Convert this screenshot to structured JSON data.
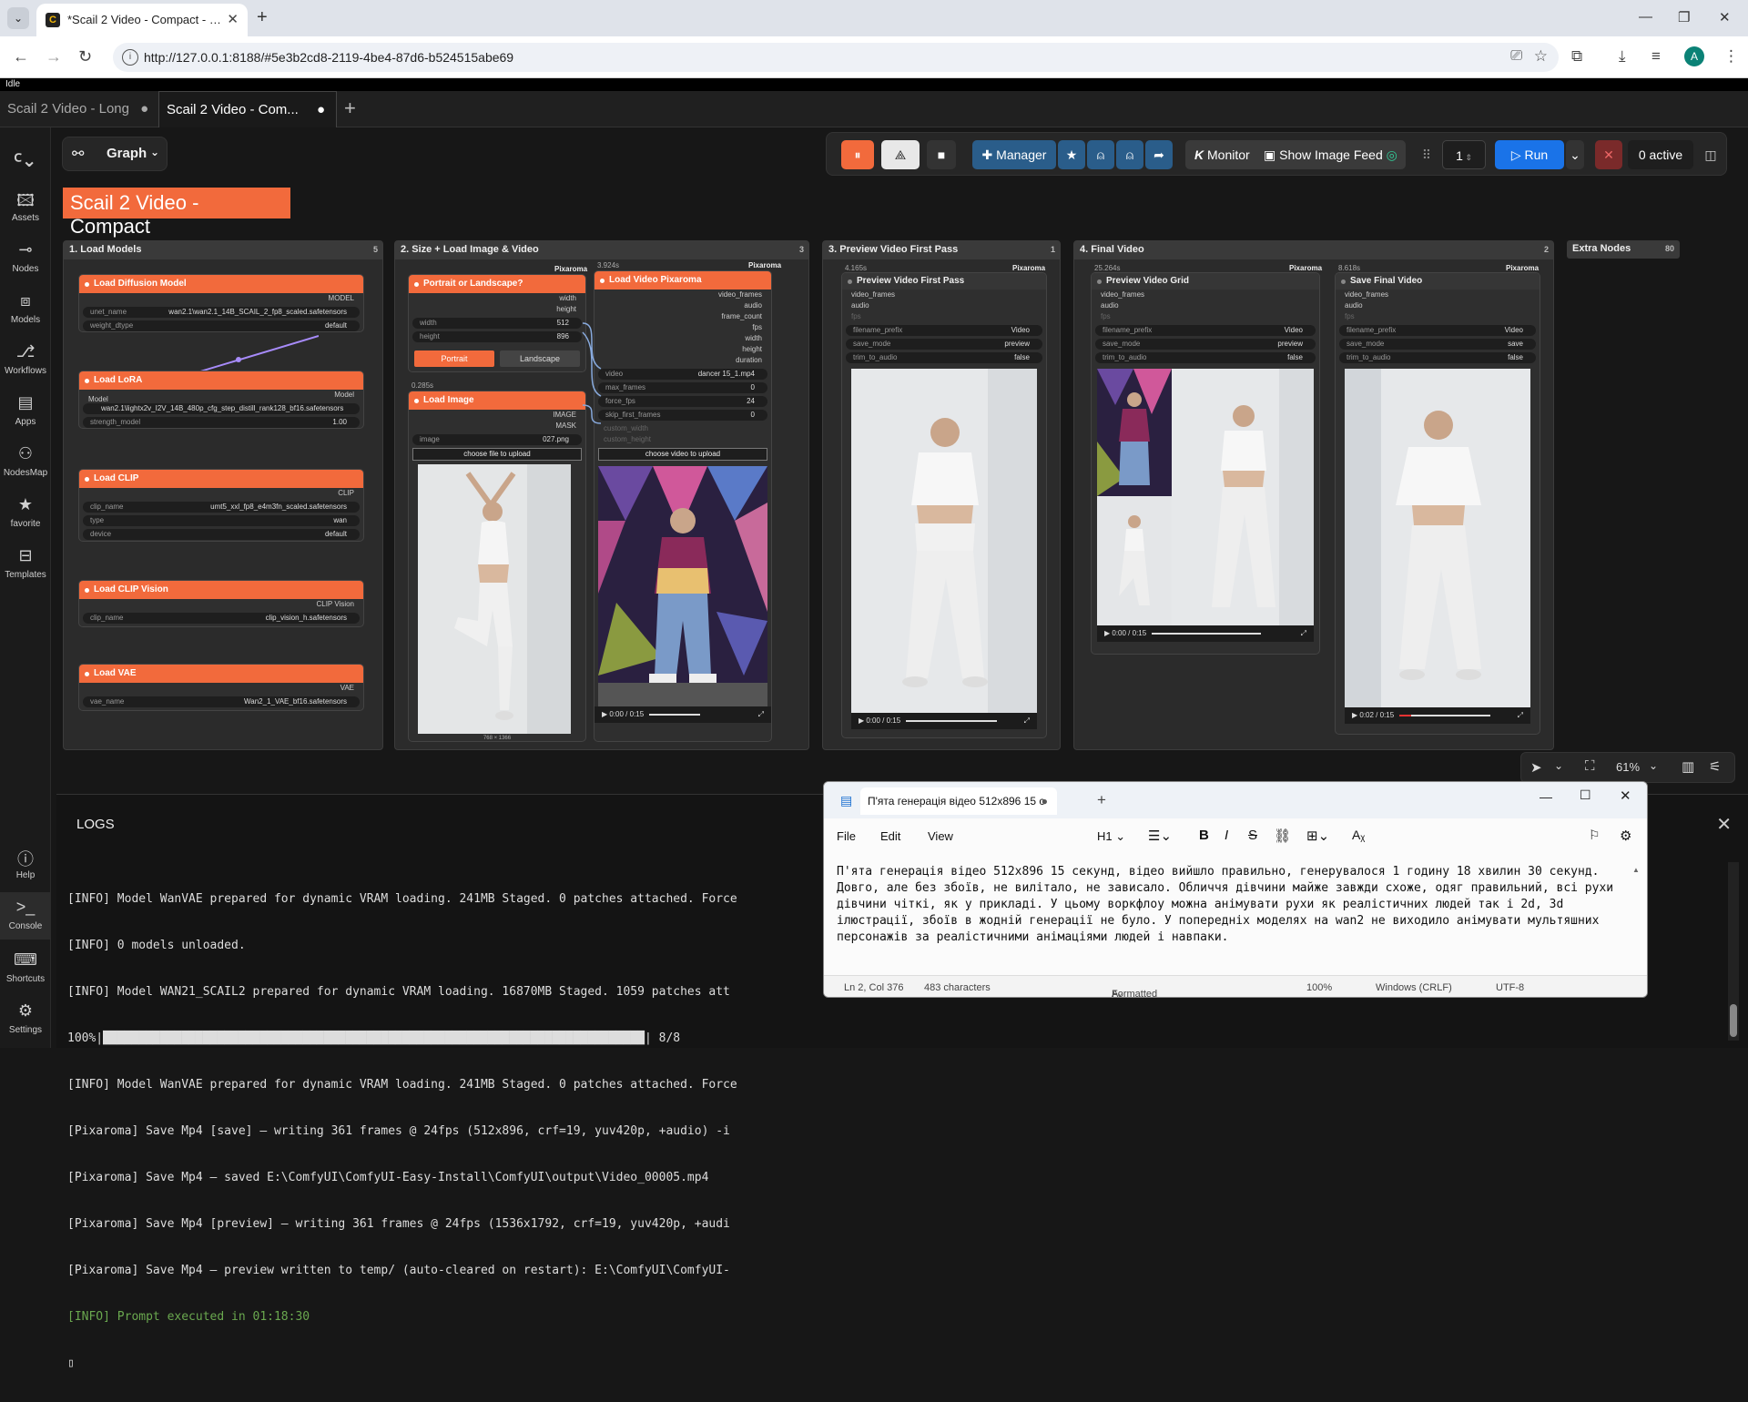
{
  "browser": {
    "tab_title": "*Scail 2 Video - Compact - Com",
    "url": "http://127.0.0.1:8188/#5e3b2cd8-2119-4be4-87d6-b524515abe69",
    "avatar_letter": "A"
  },
  "app": {
    "status": "Idle",
    "tabs": [
      {
        "label": "Scail 2 Video - Long",
        "modified": true
      },
      {
        "label": "Scail 2 Video - Com...",
        "modified": true
      }
    ],
    "graph_label": "Graph",
    "workflow_title": "Scail 2 Video - Compact",
    "sidebar": [
      {
        "label": "Assets",
        "icon": "image-icon"
      },
      {
        "label": "Nodes",
        "icon": "nodes-icon"
      },
      {
        "label": "Models",
        "icon": "cube-icon"
      },
      {
        "label": "Workflows",
        "icon": "workflow-icon"
      },
      {
        "label": "Apps",
        "icon": "apps-icon"
      },
      {
        "label": "NodesMap",
        "icon": "sitemap-icon"
      },
      {
        "label": "favorite",
        "icon": "star-icon"
      },
      {
        "label": "Templates",
        "icon": "templates-icon"
      }
    ],
    "sidebar_bottom": [
      {
        "label": "Help",
        "icon": "help-icon"
      },
      {
        "label": "Console",
        "icon": "console-icon"
      },
      {
        "label": "Shortcuts",
        "icon": "keyboard-icon"
      },
      {
        "label": "Settings",
        "icon": "gear-icon"
      }
    ],
    "toolbar": {
      "manager": "Manager",
      "monitor": "Monitor",
      "image_feed": "Show Image Feed",
      "queue_count": "1",
      "run": "Run",
      "active": "0 active"
    },
    "zoom": "61%",
    "brand_color": "#f26a3c",
    "accent_color": "#1a73e8"
  },
  "groups": {
    "g1": {
      "title": "1. Load Models",
      "badge": "5"
    },
    "g2": {
      "title": "2. Size + Load Image & Video",
      "badge": "3"
    },
    "g3": {
      "title": "3. Preview Video First Pass",
      "badge": "1"
    },
    "g4": {
      "title": "4. Final Video",
      "badge": "2"
    },
    "g5": {
      "title": "Extra Nodes",
      "badge": "80"
    }
  },
  "nodes": {
    "diffusion": {
      "title": "Load Diffusion Model",
      "output": "MODEL",
      "unet_label": "unet_name",
      "unet": "wan2.1\\wan2.1_14B_SCAIL_2_fp8_scaled.safetensors",
      "dtype_label": "weight_dtype",
      "dtype": "default"
    },
    "lora": {
      "title": "Load LoRA",
      "input": "Model",
      "output": "Model",
      "name": "wan2.1\\lightx2v_I2V_14B_480p_cfg_step_distill_rank128_bf16.safetensors",
      "strength_label": "strength_model",
      "strength": "1.00"
    },
    "clip": {
      "title": "Load CLIP",
      "output": "CLIP",
      "name_label": "clip_name",
      "name": "umt5_xxl_fp8_e4m3fn_scaled.safetensors",
      "type_label": "type",
      "type": "wan",
      "device_label": "device",
      "device": "default"
    },
    "clipvision": {
      "title": "Load CLIP Vision",
      "output": "CLIP Vision",
      "name_label": "clip_name",
      "name": "clip_vision_h.safetensors"
    },
    "vae": {
      "title": "Load VAE",
      "output": "VAE",
      "name_label": "vae_name",
      "name": "Wan2_1_VAE_bf16.safetensors"
    },
    "portrait": {
      "title": "Portrait or Landscape?",
      "out1": "width",
      "out2": "height",
      "width_label": "width",
      "width": "512",
      "height_label": "height",
      "height": "896",
      "btn1": "Portrait",
      "btn2": "Landscape",
      "tag": "Pixaroma"
    },
    "loadimage": {
      "title": "Load Image",
      "time": "0.285s",
      "out1": "IMAGE",
      "out2": "MASK",
      "image_label": "image",
      "image": "027.png",
      "upload": "choose file to upload",
      "dims": "768 × 1366"
    },
    "loadvideo": {
      "title": "Load Video Pixaroma",
      "time": "3.924s",
      "tag": "Pixaroma",
      "outputs": [
        "video_frames",
        "audio",
        "frame_count",
        "fps",
        "width",
        "height",
        "duration"
      ],
      "widgets": [
        {
          "label": "video",
          "value": "dancer 15_1.mp4"
        },
        {
          "label": "max_frames",
          "value": "0"
        },
        {
          "label": "force_fps",
          "value": "24"
        },
        {
          "label": "skip_first_frames",
          "value": "0"
        }
      ],
      "disabled": [
        "custom_width",
        "custom_height"
      ],
      "upload": "choose video to upload",
      "time_display": "0:00 / 0:15"
    },
    "preview1": {
      "title": "Preview Video First Pass",
      "time": "4.165s",
      "tag": "Pixaroma",
      "inputs": [
        "video_frames",
        "audio",
        "fps"
      ],
      "widgets": [
        {
          "label": "filename_prefix",
          "value": "Video"
        },
        {
          "label": "save_mode",
          "value": "preview"
        },
        {
          "label": "trim_to_audio",
          "value": "false"
        }
      ],
      "time_display": "0:00 / 0:15"
    },
    "grid": {
      "title": "Preview Video Grid",
      "time": "25.264s",
      "tag": "Pixaroma",
      "inputs": [
        "video_frames",
        "audio",
        "fps"
      ],
      "widgets": [
        {
          "label": "filename_prefix",
          "value": "Video"
        },
        {
          "label": "save_mode",
          "value": "preview"
        },
        {
          "label": "trim_to_audio",
          "value": "false"
        }
      ],
      "time_display": "0:00 / 0:15"
    },
    "final": {
      "title": "Save Final Video",
      "time": "8.618s",
      "tag": "Pixaroma",
      "inputs": [
        "video_frames",
        "audio",
        "fps"
      ],
      "widgets": [
        {
          "label": "filename_prefix",
          "value": "Video"
        },
        {
          "label": "save_mode",
          "value": "save"
        },
        {
          "label": "trim_to_audio",
          "value": "false"
        }
      ],
      "time_display": "0:02 / 0:15",
      "progress": 0.13
    }
  },
  "logs": {
    "title": "LOGS",
    "lines": [
      {
        "text": "[INFO] Model WanVAE prepared for dynamic VRAM loading. 241MB Staged. 0 patches attached. Force",
        "type": "info"
      },
      {
        "text": "[INFO] 0 models unloaded.",
        "type": "info"
      },
      {
        "text": "[INFO] Model WAN21_SCAIL2 prepared for dynamic VRAM loading. 16870MB Staged. 1059 patches att",
        "type": "info"
      },
      {
        "text": "100%|████████████████████████████████████████████████████████████████████████████| 8/8",
        "type": "plain"
      },
      {
        "text": "[INFO] Model WanVAE prepared for dynamic VRAM loading. 241MB Staged. 0 patches attached. Force",
        "type": "info"
      },
      {
        "text": "[Pixaroma] Save Mp4 [save] — writing 361 frames @ 24fps (512x896, crf=19, yuv420p, +audio) -i",
        "type": "plain"
      },
      {
        "text": "[Pixaroma] Save Mp4 — saved E:\\ComfyUI\\ComfyUI-Easy-Install\\ComfyUI\\output\\Video_00005.mp4",
        "type": "plain"
      },
      {
        "text": "[Pixaroma] Save Mp4 [preview] — writing 361 frames @ 24fps (1536x1792, crf=19, yuv420p, +audi",
        "type": "plain"
      },
      {
        "text": "[Pixaroma] Save Mp4 — preview written to temp/ (auto-cleared on restart): E:\\ComfyUI\\ComfyUI-",
        "type": "plain"
      },
      {
        "text": "[INFO] Prompt executed in 01:18:30",
        "type": "green"
      }
    ]
  },
  "notepad": {
    "tab_title": "П'ята генерація відео 512x896 15 с",
    "menu": [
      "File",
      "Edit",
      "View"
    ],
    "heading": "H1",
    "text": "П'ята генерація відео 512x896 15 секунд, відео вийшло правильно, генерувалося 1 годину 18 хвилин 30 секунд. Довго, але без збоїв, не вилітало, не зависало. Обличчя дівчини майже завжди схоже, одяг правильний, всі рухи дівчини чіткі, як у прикладі. У цьому воркфлоу можна анімувати рухи як реалістичних людей так і 2d, 3d ілюстрації, збоїв в жодній генерації не було. У попередніх моделях на wan2 не виходило анімувати мультяшних персонажів за реалістичними анімаціями людей і навпаки.",
    "status": {
      "position": "Ln 2, Col 376",
      "chars": "483 characters",
      "format": "Formatted",
      "zoom": "100%",
      "eol": "Windows (CRLF)",
      "encoding": "UTF-8"
    }
  }
}
